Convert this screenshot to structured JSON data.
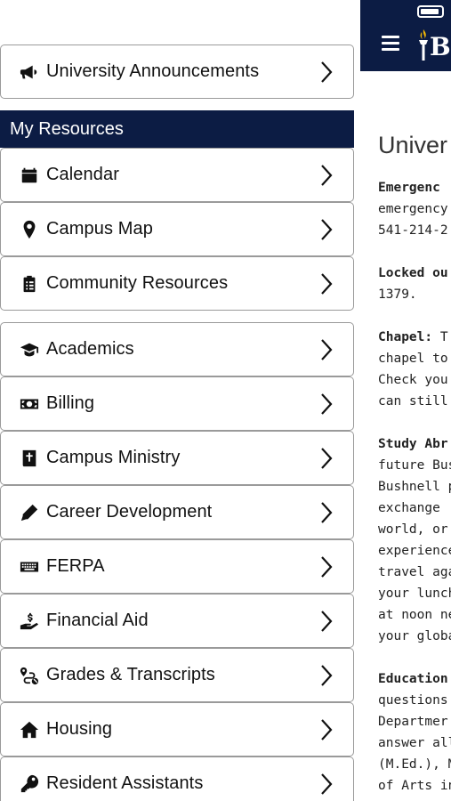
{
  "background_app": {
    "logo_letter": "B",
    "logo_sub": "U",
    "page_title": "Univer",
    "paragraphs": [
      {
        "lead": "Emergenc",
        "lines": [
          "emergency",
          "541-214-2"
        ]
      },
      {
        "lead": "Locked ou",
        "lines": [
          "1379."
        ]
      },
      {
        "lead": "Chapel:",
        "lead_rest": " T",
        "lines": [
          "chapel to p",
          "Check you",
          "can still re"
        ]
      },
      {
        "lead": "Study Abr",
        "lines": [
          "future Bus",
          "Bushnell p",
          "exchange",
          "world, or h",
          "experience",
          "travel agai",
          "your lunch",
          "at noon ne",
          "your globa"
        ]
      },
      {
        "lead": "Education",
        "lines": [
          "questions",
          "Departmer",
          "answer all",
          "(M.Ed.), M",
          "of Arts in S"
        ]
      }
    ]
  },
  "menu": {
    "top_item": {
      "label": "University Announcements",
      "icon": "megaphone-icon"
    },
    "section_header": "My Resources",
    "resources": [
      {
        "label": "Calendar",
        "icon": "calendar-icon"
      },
      {
        "label": "Campus Map",
        "icon": "map-pin-icon"
      },
      {
        "label": "Community Resources",
        "icon": "clipboard-list-icon"
      }
    ],
    "items": [
      {
        "label": "Academics",
        "icon": "graduation-cap-icon"
      },
      {
        "label": "Billing",
        "icon": "money-bill-icon"
      },
      {
        "label": "Campus Ministry",
        "icon": "bible-icon"
      },
      {
        "label": "Career Development",
        "icon": "pen-icon"
      },
      {
        "label": "FERPA",
        "icon": "keyboard-icon"
      },
      {
        "label": "Financial Aid",
        "icon": "hand-dollar-icon"
      },
      {
        "label": "Grades & Transcripts",
        "icon": "route-icon"
      },
      {
        "label": "Housing",
        "icon": "home-icon"
      },
      {
        "label": "Resident Assistants",
        "icon": "key-icon"
      }
    ]
  },
  "colors": {
    "navy": "#0c1c44",
    "border": "#9a9a9a"
  }
}
